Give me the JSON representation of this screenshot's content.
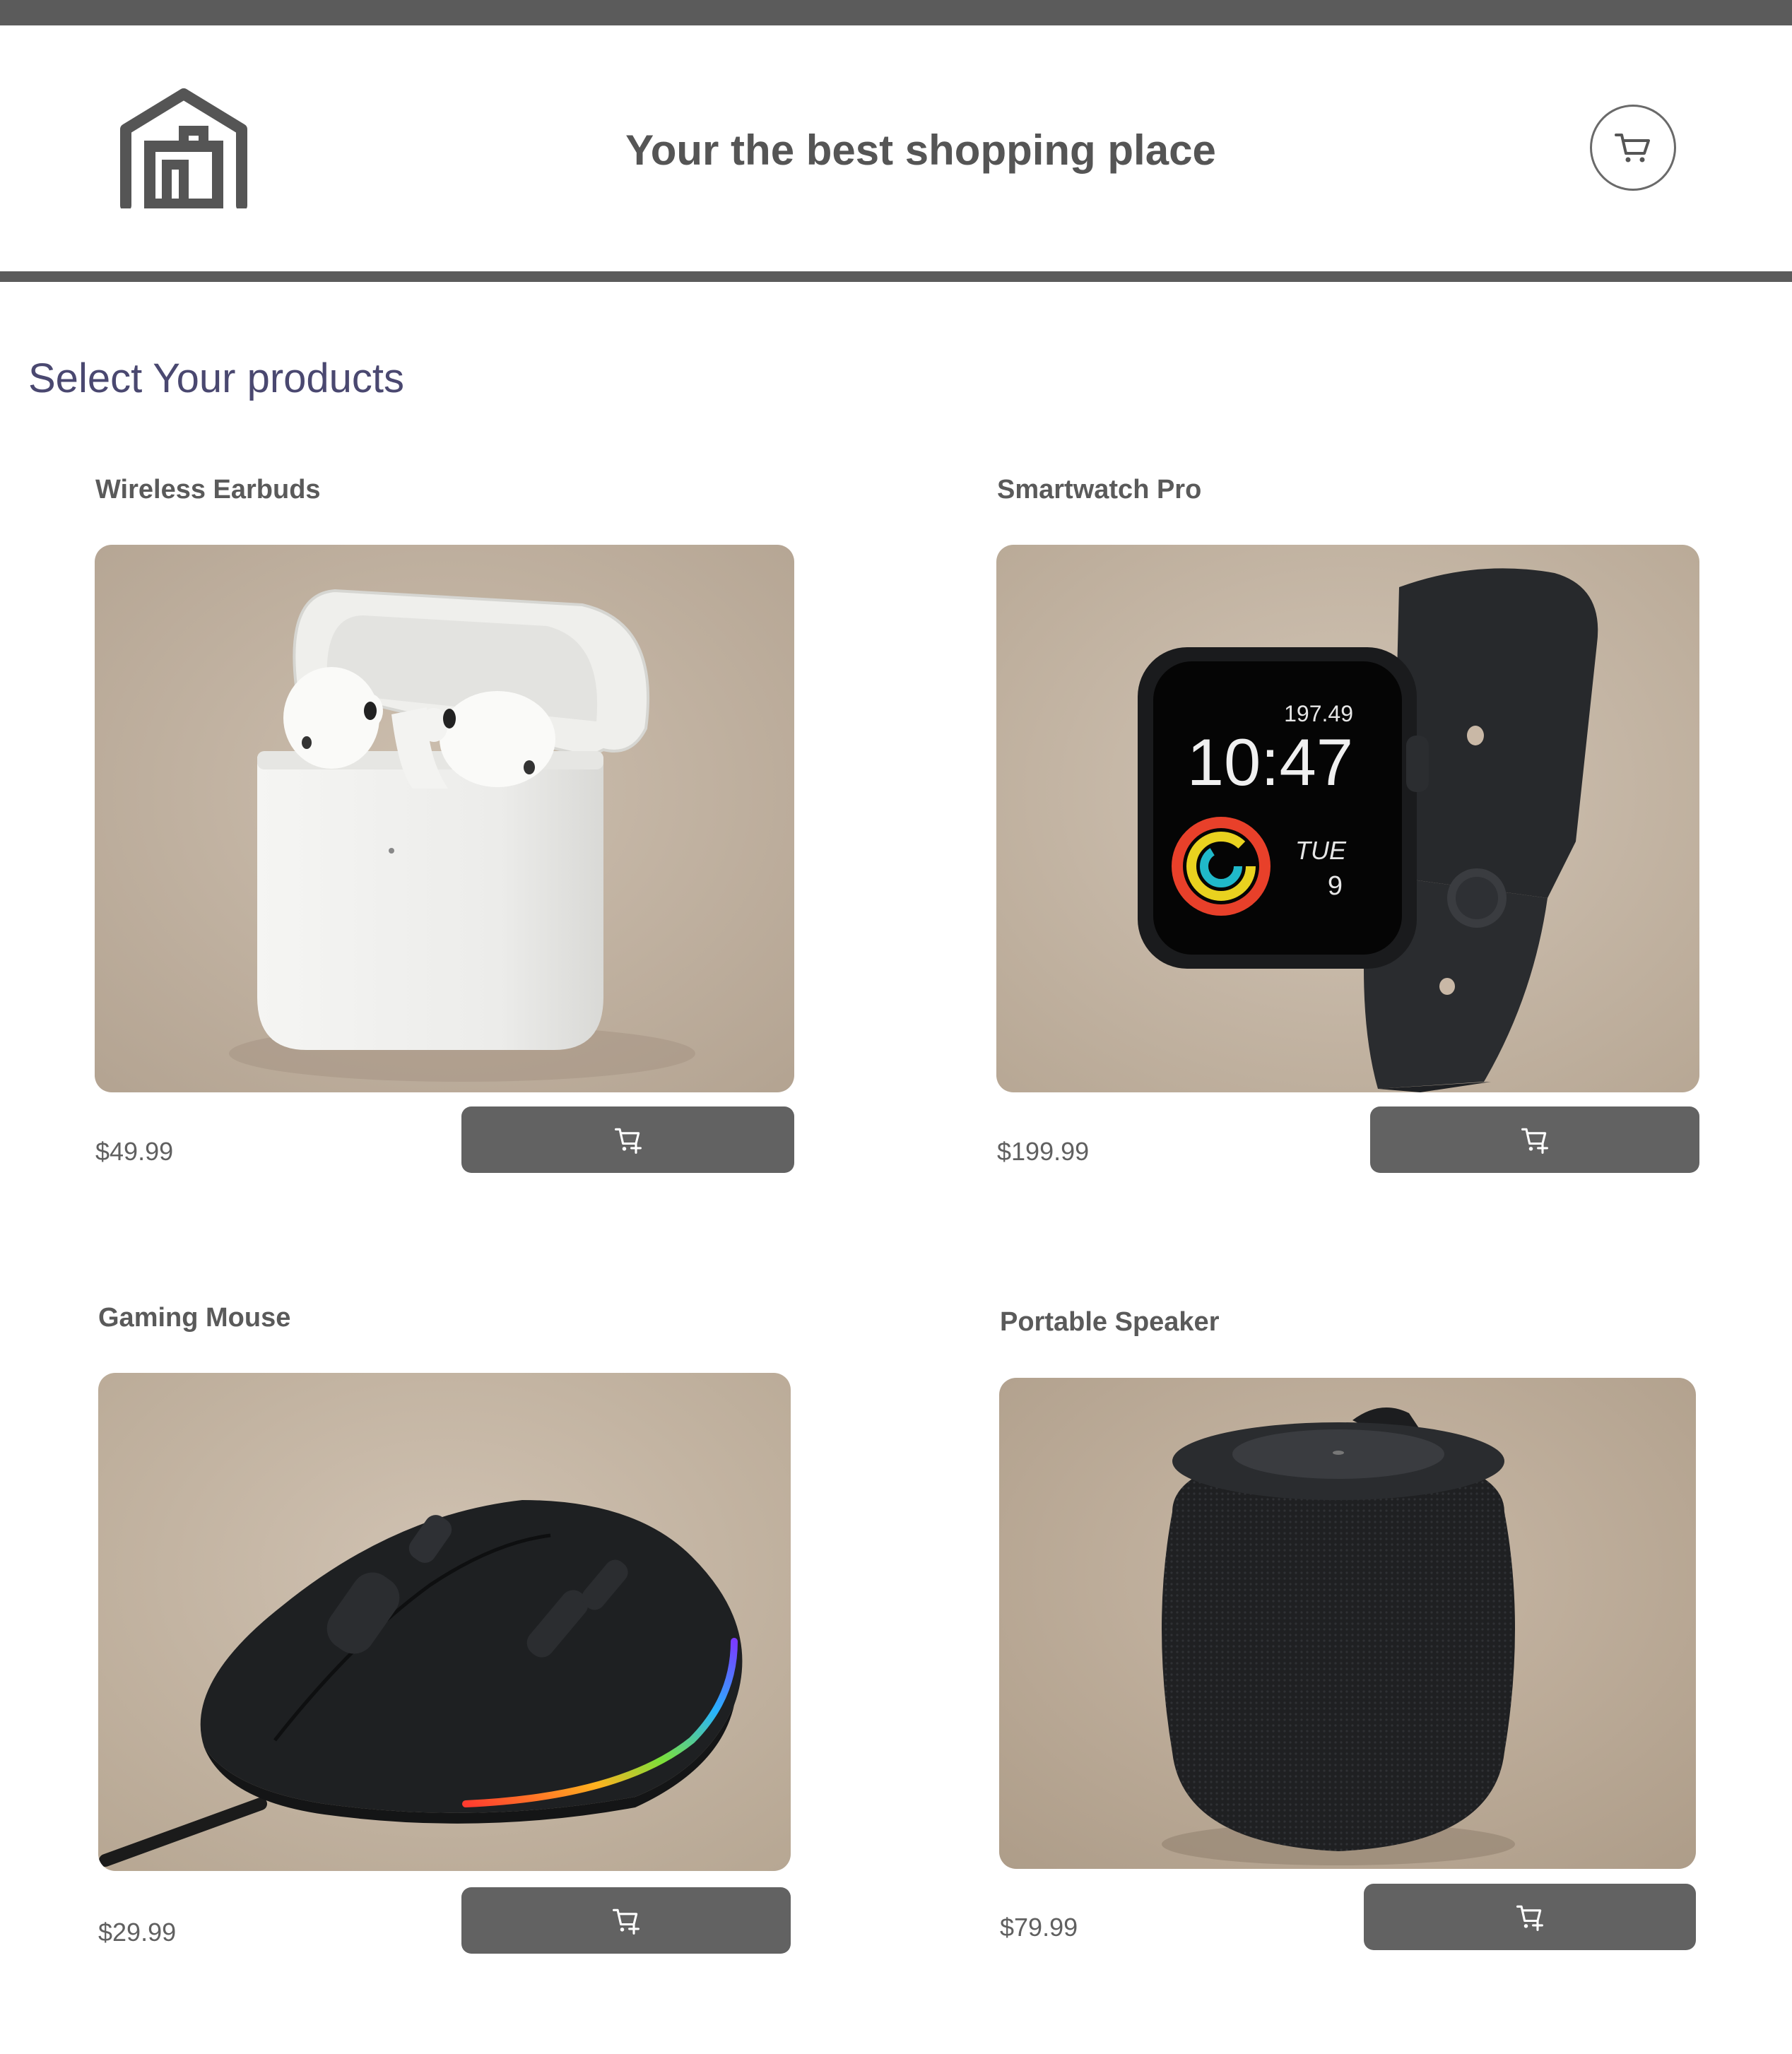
{
  "header": {
    "title": "Your the best shopping place",
    "logo_icon": "store-icon",
    "cart_icon": "cart-icon"
  },
  "main": {
    "section_title": "Select Your products",
    "products": [
      {
        "name": "Wireless Earbuds",
        "price": "$49.99",
        "image": "earbuds-photo",
        "button_icon": "cart-add-icon"
      },
      {
        "name": "Smartwatch Pro",
        "price": "$199.99",
        "image": "smartwatch-photo",
        "button_icon": "cart-add-icon",
        "watch_face": {
          "top_value": "197.49",
          "time": "10:47",
          "day": "TUE",
          "date": "9"
        }
      },
      {
        "name": "Gaming Mouse",
        "price": "$29.99",
        "image": "gaming-mouse-photo",
        "button_icon": "cart-add-icon"
      },
      {
        "name": "Portable Speaker",
        "price": "$79.99",
        "image": "speaker-photo",
        "button_icon": "cart-add-icon"
      }
    ]
  },
  "colors": {
    "bar": "#5b5b5b",
    "button": "#626262",
    "section_title": "#4a4870",
    "photo_background": "#c9b8a6"
  }
}
